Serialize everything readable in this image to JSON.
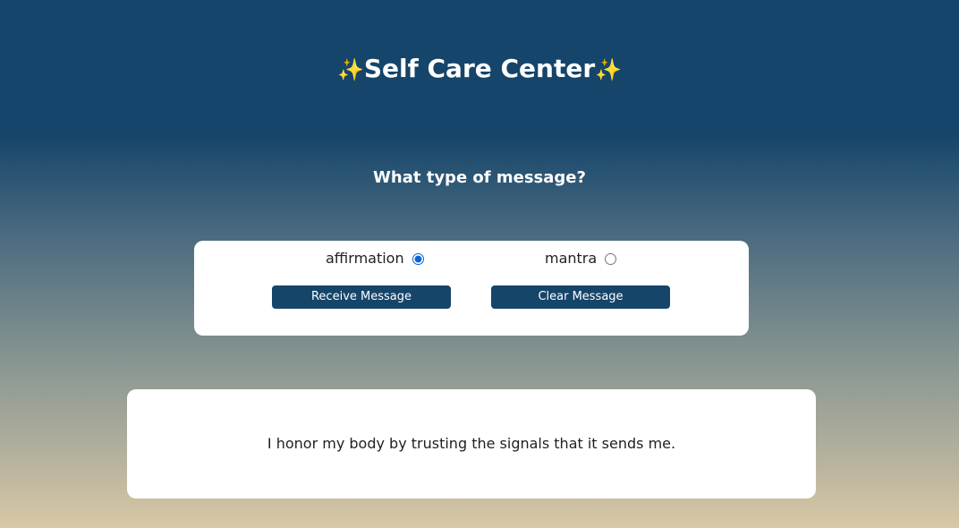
{
  "header": {
    "title": "Self Care Center"
  },
  "prompt": {
    "question": "What type of message?"
  },
  "options": {
    "affirmation": {
      "label": "affirmation",
      "selected": true
    },
    "mantra": {
      "label": "mantra",
      "selected": false
    }
  },
  "actions": {
    "receive_label": "Receive Message",
    "clear_label": "Clear Message"
  },
  "message": {
    "text": "I honor my body by trusting the signals that it sends me."
  },
  "colors": {
    "header_blue": "#15456a",
    "button_blue": "#16456a",
    "sparkle_gold": "#f5d142",
    "radio_accent": "#0a66d8",
    "panel_white": "#ffffff"
  },
  "icons": {
    "title_left": "sparkles-icon",
    "title_right": "sparkles-icon"
  }
}
